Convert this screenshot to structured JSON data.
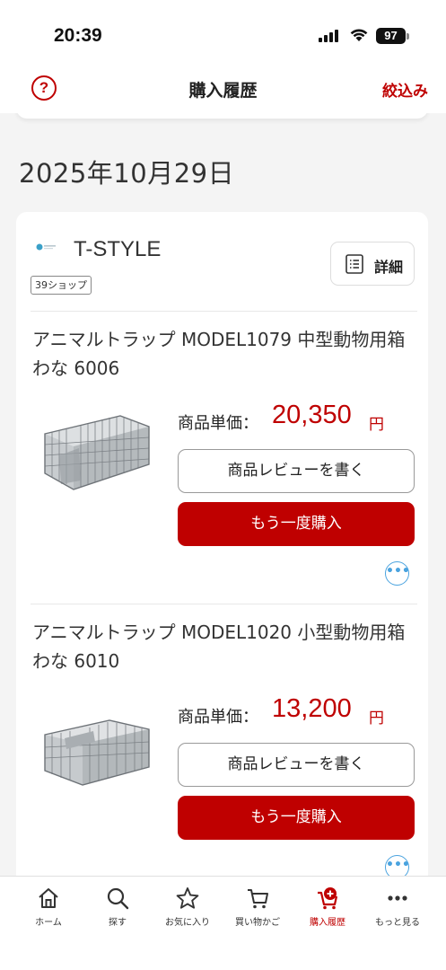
{
  "status_bar": {
    "time": "20:39",
    "battery": "97"
  },
  "header": {
    "title": "購入履歴",
    "filter_label": "絞込み"
  },
  "order": {
    "date": "2025年10月29日",
    "shop": {
      "name": "T-STYLE",
      "badge": "39ショップ",
      "detail_label": "詳細"
    },
    "items": [
      {
        "title": "アニマルトラップ MODEL1079 中型動物用箱わな 6006",
        "price_label": "商品単価：",
        "price": "20,350",
        "currency": "円",
        "review_label": "商品レビューを書く",
        "rebuy_label": "もう一度購入"
      },
      {
        "title": "アニマルトラップ MODEL1020 小型動物用箱わな 6010",
        "price_label": "商品単価：",
        "price": "13,200",
        "currency": "円",
        "review_label": "商品レビューを書く",
        "rebuy_label": "もう一度購入"
      }
    ]
  },
  "tab_bar": {
    "tabs": [
      {
        "label": "ホーム",
        "icon": "home-icon"
      },
      {
        "label": "探す",
        "icon": "search-icon"
      },
      {
        "label": "お気に入り",
        "icon": "star-icon"
      },
      {
        "label": "買い物かご",
        "icon": "cart-icon"
      },
      {
        "label": "購入履歴",
        "icon": "purchase-history-icon"
      },
      {
        "label": "もっと見る",
        "icon": "more-icon"
      }
    ],
    "active_index": 4
  },
  "colors": {
    "accent": "#bf0000",
    "link": "#4aa3df"
  }
}
